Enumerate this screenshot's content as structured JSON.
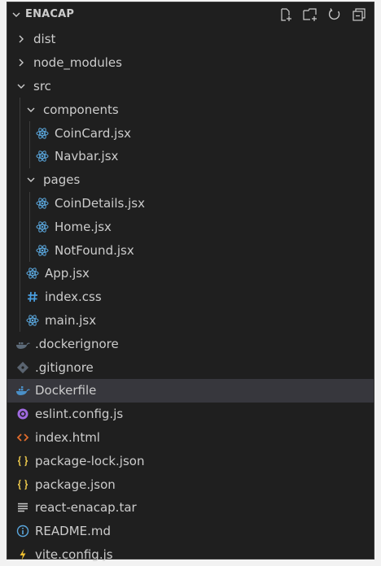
{
  "explorer": {
    "title": "ENACAP",
    "actions": [
      {
        "name": "new-file-icon"
      },
      {
        "name": "new-folder-icon"
      },
      {
        "name": "refresh-icon"
      },
      {
        "name": "collapse-all-icon"
      }
    ]
  },
  "tree": [
    {
      "label": "dist",
      "kind": "folder",
      "expanded": false,
      "depth": 0
    },
    {
      "label": "node_modules",
      "kind": "folder",
      "expanded": false,
      "depth": 0
    },
    {
      "label": "src",
      "kind": "folder",
      "expanded": true,
      "depth": 0
    },
    {
      "label": "components",
      "kind": "folder",
      "expanded": true,
      "depth": 1
    },
    {
      "label": "CoinCard.jsx",
      "kind": "react",
      "depth": 2
    },
    {
      "label": "Navbar.jsx",
      "kind": "react",
      "depth": 2
    },
    {
      "label": "pages",
      "kind": "folder",
      "expanded": true,
      "depth": 1
    },
    {
      "label": "CoinDetails.jsx",
      "kind": "react",
      "depth": 2
    },
    {
      "label": "Home.jsx",
      "kind": "react",
      "depth": 2
    },
    {
      "label": "NotFound.jsx",
      "kind": "react",
      "depth": 2
    },
    {
      "label": "App.jsx",
      "kind": "react",
      "depth": 1
    },
    {
      "label": "index.css",
      "kind": "css",
      "depth": 1
    },
    {
      "label": "main.jsx",
      "kind": "react",
      "depth": 1
    },
    {
      "label": ".dockerignore",
      "kind": "dockerignore",
      "depth": 0
    },
    {
      "label": ".gitignore",
      "kind": "git",
      "depth": 0
    },
    {
      "label": "Dockerfile",
      "kind": "docker",
      "depth": 0,
      "selected": true
    },
    {
      "label": "eslint.config.js",
      "kind": "eslint",
      "depth": 0
    },
    {
      "label": "index.html",
      "kind": "html",
      "depth": 0
    },
    {
      "label": "package-lock.json",
      "kind": "json",
      "depth": 0
    },
    {
      "label": "package.json",
      "kind": "json",
      "depth": 0
    },
    {
      "label": "react-enacap.tar",
      "kind": "tar",
      "depth": 0
    },
    {
      "label": "README.md",
      "kind": "info",
      "depth": 0
    },
    {
      "label": "vite.config.js",
      "kind": "vite",
      "depth": 0
    }
  ],
  "colors": {
    "background": "#1f1f1f",
    "text": "#cccccc",
    "selected": "#37373d",
    "react": "#5aa6dc",
    "css": "#4a9fe0",
    "docker": "#4a90c8",
    "git": "#5a6470",
    "eslint": "#a06ae0",
    "html": "#e06c2c",
    "json": "#e2c04a",
    "info": "#5aa6dc",
    "vite": "#f0c030"
  }
}
